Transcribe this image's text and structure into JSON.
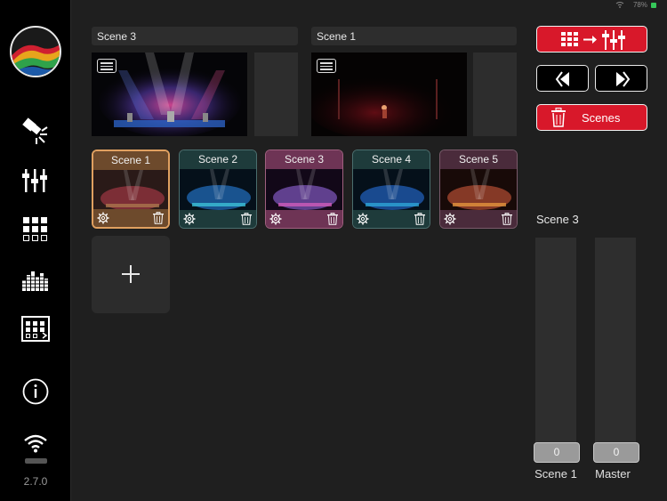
{
  "status": {
    "battery_text": "78%"
  },
  "sidebar": {
    "version": "2.7.0",
    "icons": [
      "spotlight-icon",
      "faders-icon",
      "grid-icon",
      "equalizer-icon",
      "calendar-grid-icon",
      "info-icon",
      "wifi-icon"
    ]
  },
  "preview": {
    "left_scene": "Scene 3",
    "right_scene": "Scene 1"
  },
  "scenes": [
    {
      "label": "Scene 1",
      "title_color": "#6d4a2c",
      "foot_color": "#6d4a2c",
      "border": "#e0a060",
      "selected": true
    },
    {
      "label": "Scene 2",
      "title_color": "#1e3b3b",
      "foot_color": "#1e3b3b",
      "border": "#4a6e6e",
      "selected": false
    },
    {
      "label": "Scene 3",
      "title_color": "#6e3455",
      "foot_color": "#6e3455",
      "border": "#a0607f",
      "selected": false
    },
    {
      "label": "Scene 4",
      "title_color": "#1e3b3b",
      "foot_color": "#1e3b3b",
      "border": "#4a6e6e",
      "selected": false
    },
    {
      "label": "Scene 5",
      "title_color": "#4a2b3b",
      "foot_color": "#4a2b3b",
      "border": "#7a5a6a",
      "selected": false
    }
  ],
  "right_panel": {
    "scenes_button_label": "Scenes",
    "fader_section_label": "Scene 3",
    "faders": [
      {
        "label": "Scene 1",
        "value": "0"
      },
      {
        "label": "Master",
        "value": "0"
      }
    ]
  },
  "colors": {
    "accent_red": "#d8182a",
    "background": "#1f1f1f"
  }
}
